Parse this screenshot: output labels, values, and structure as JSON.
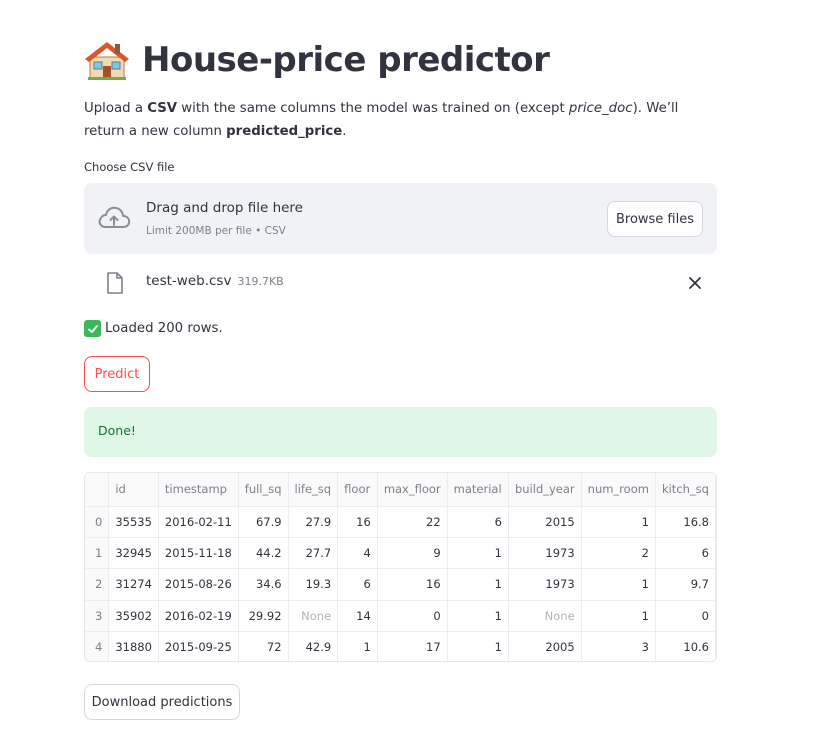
{
  "header": {
    "title": "House-price predictor",
    "icon": "house-emoji-icon"
  },
  "intro": {
    "p1": "Upload a ",
    "csv": "CSV",
    "p2": " with the same columns the model was trained on (except ",
    "price_doc": "price_doc",
    "p3": "). We’ll return a new column ",
    "predicted_price": "predicted_price",
    "p4": "."
  },
  "uploader": {
    "label": "Choose CSV file",
    "drop_text": "Drag and drop file here",
    "limit_text": "Limit 200MB per file • CSV",
    "browse_label": "Browse files",
    "icon": "cloud-upload-icon"
  },
  "file": {
    "name": "test-web.csv",
    "size": "319.7KB",
    "icon": "file-icon"
  },
  "status": {
    "loaded_text": "Loaded 200 rows.",
    "icon": "check-mark-icon"
  },
  "predict_label": "Predict",
  "done_text": "Done!",
  "table": {
    "columns": [
      "",
      "id",
      "timestamp",
      "full_sq",
      "life_sq",
      "floor",
      "max_floor",
      "material",
      "build_year",
      "num_room",
      "kitch_sq"
    ],
    "rows": [
      [
        "0",
        "35535",
        "2016-02-11",
        "67.9",
        "27.9",
        "16",
        "22",
        "6",
        "2015",
        "1",
        "16.8"
      ],
      [
        "1",
        "32945",
        "2015-11-18",
        "44.2",
        "27.7",
        "4",
        "9",
        "1",
        "1973",
        "2",
        "6"
      ],
      [
        "2",
        "31274",
        "2015-08-26",
        "34.6",
        "19.3",
        "6",
        "16",
        "1",
        "1973",
        "1",
        "9.7"
      ],
      [
        "3",
        "35902",
        "2016-02-19",
        "29.92",
        "None",
        "14",
        "0",
        "1",
        "None",
        "1",
        "0"
      ],
      [
        "4",
        "31880",
        "2015-09-25",
        "72",
        "42.9",
        "1",
        "17",
        "1",
        "2005",
        "3",
        "10.6"
      ]
    ]
  },
  "download_label": "Download predictions",
  "colors": {
    "accent": "#ff4b4b",
    "success_bg": "#dff7e6",
    "success_text": "#177233",
    "dropzone_bg": "#f0f2f6"
  }
}
